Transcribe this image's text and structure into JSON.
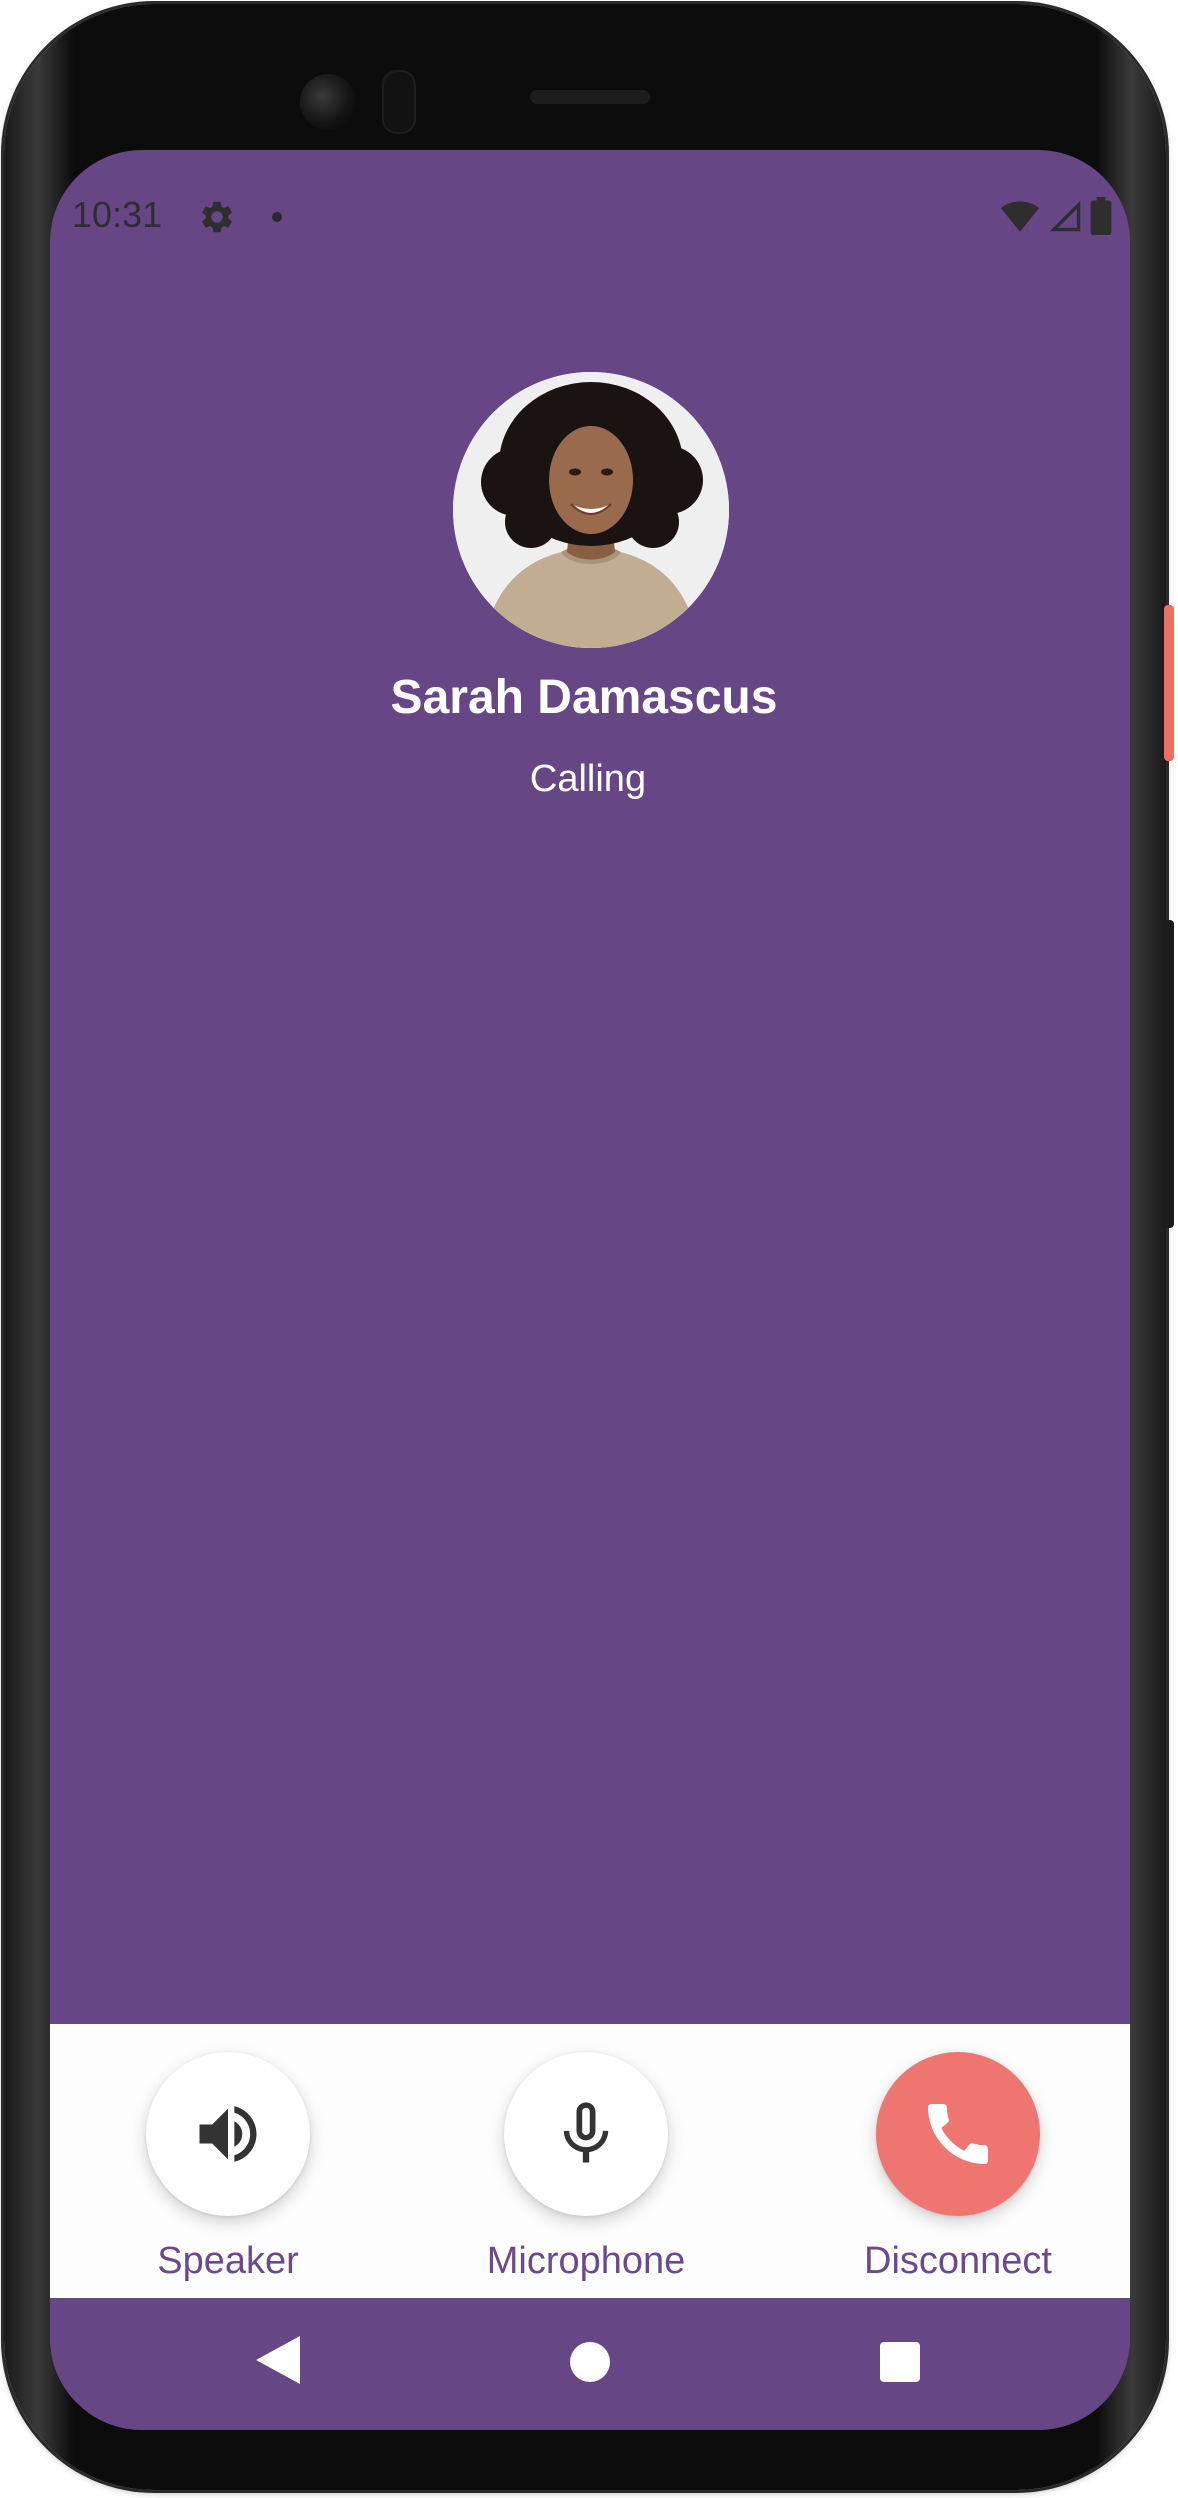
{
  "status_bar": {
    "time": "10:31",
    "icons": [
      "settings-icon",
      "notification-dot-icon",
      "wifi-icon",
      "signal-icon",
      "battery-icon"
    ]
  },
  "caller": {
    "name": "Sarah Damascus",
    "status": "Calling",
    "avatar": "woman-with-curly-hair-photo"
  },
  "controls": [
    {
      "label": "Speaker",
      "icon": "speaker-icon"
    },
    {
      "label": "Microphone",
      "icon": "microphone-icon"
    },
    {
      "label": "Disconnect",
      "icon": "phone-hangup-icon"
    }
  ],
  "navigation": {
    "icons": [
      "back-icon",
      "home-icon",
      "recents-icon"
    ]
  },
  "colors": {
    "background": "#674686",
    "controls_background": "#fdfdfe",
    "label": "#6a4a8c",
    "disconnect": "#ef7670",
    "text_on_background": "#ffffff"
  }
}
